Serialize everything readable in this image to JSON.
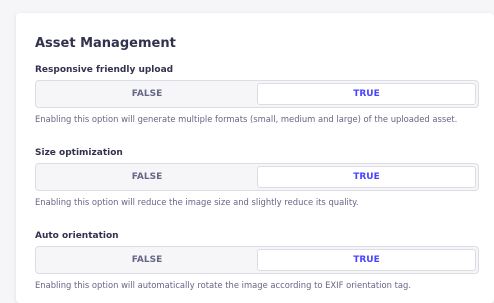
{
  "section": {
    "title": "Asset Management"
  },
  "settings": [
    {
      "label": "Responsive friendly upload",
      "false_label": "FALSE",
      "true_label": "TRUE",
      "selected": "TRUE",
      "hint": "Enabling this option will generate multiple formats (small, medium and large) of the uploaded asset."
    },
    {
      "label": "Size optimization",
      "false_label": "FALSE",
      "true_label": "TRUE",
      "selected": "TRUE",
      "hint": "Enabling this option will reduce the image size and slightly reduce its quality."
    },
    {
      "label": "Auto orientation",
      "false_label": "FALSE",
      "true_label": "TRUE",
      "selected": "TRUE",
      "hint": "Enabling this option will automatically rotate the image according to EXIF orientation tag."
    }
  ],
  "colors": {
    "accent": "#4945ff",
    "text_primary": "#32324d",
    "text_secondary": "#666687",
    "border": "#dcdce4",
    "muted_bg": "#f6f6f9"
  }
}
